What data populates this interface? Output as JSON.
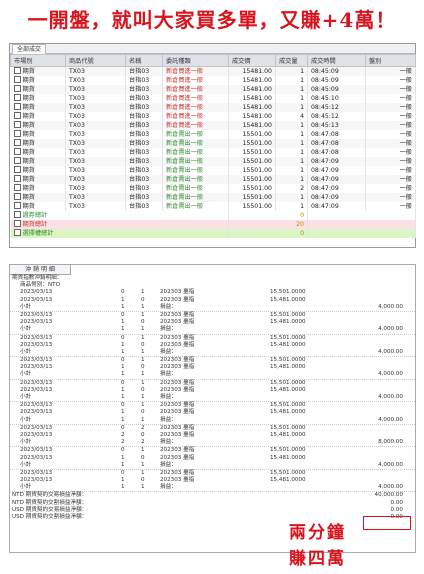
{
  "headline": "一開盤，就叫大家買多單，又賺+4萬！",
  "panel1": {
    "tab": "全部成交",
    "columns": [
      "市場別",
      "商品代號",
      "名稱",
      "委託種類",
      "成交價",
      "成交量",
      "成交時間",
      "盤別"
    ],
    "rows": [
      {
        "market": "期貨",
        "code": "TX03",
        "name": "台指03",
        "type": "新倉買進一般",
        "price": "15481.00",
        "qty": "1",
        "time": "08:45:09",
        "session": "一般",
        "side": "buy"
      },
      {
        "market": "期貨",
        "code": "TX03",
        "name": "台指03",
        "type": "新倉買進一般",
        "price": "15481.00",
        "qty": "1",
        "time": "08:45:09",
        "session": "一般",
        "side": "buy"
      },
      {
        "market": "期貨",
        "code": "TX03",
        "name": "台指03",
        "type": "新倉買進一般",
        "price": "15481.00",
        "qty": "1",
        "time": "08:45:09",
        "session": "一般",
        "side": "buy"
      },
      {
        "market": "期貨",
        "code": "TX03",
        "name": "台指03",
        "type": "新倉買進一般",
        "price": "15481.00",
        "qty": "1",
        "time": "08:45:10",
        "session": "一般",
        "side": "buy"
      },
      {
        "market": "期貨",
        "code": "TX03",
        "name": "台指03",
        "type": "新倉買進一般",
        "price": "15481.00",
        "qty": "1",
        "time": "08:45:12",
        "session": "一般",
        "side": "buy"
      },
      {
        "market": "期貨",
        "code": "TX03",
        "name": "台指03",
        "type": "新倉買進一般",
        "price": "15481.00",
        "qty": "4",
        "time": "08:45:12",
        "session": "一般",
        "side": "buy"
      },
      {
        "market": "期貨",
        "code": "TX03",
        "name": "台指03",
        "type": "新倉買進一般",
        "price": "15481.00",
        "qty": "1",
        "time": "08:45:13",
        "session": "一般",
        "side": "buy"
      },
      {
        "market": "期貨",
        "code": "TX03",
        "name": "台指03",
        "type": "新倉賣出一般",
        "price": "15501.00",
        "qty": "1",
        "time": "08:47:08",
        "session": "一般",
        "side": "sell"
      },
      {
        "market": "期貨",
        "code": "TX03",
        "name": "台指03",
        "type": "新倉賣出一般",
        "price": "15501.00",
        "qty": "1",
        "time": "08:47:08",
        "session": "一般",
        "side": "sell"
      },
      {
        "market": "期貨",
        "code": "TX03",
        "name": "台指03",
        "type": "新倉賣出一般",
        "price": "15501.00",
        "qty": "1",
        "time": "08:47:08",
        "session": "一般",
        "side": "sell"
      },
      {
        "market": "期貨",
        "code": "TX03",
        "name": "台指03",
        "type": "新倉賣出一般",
        "price": "15501.00",
        "qty": "1",
        "time": "08:47:09",
        "session": "一般",
        "side": "sell"
      },
      {
        "market": "期貨",
        "code": "TX03",
        "name": "台指03",
        "type": "新倉賣出一般",
        "price": "15501.00",
        "qty": "1",
        "time": "08:47:09",
        "session": "一般",
        "side": "sell"
      },
      {
        "market": "期貨",
        "code": "TX03",
        "name": "台指03",
        "type": "新倉賣出一般",
        "price": "15501.00",
        "qty": "1",
        "time": "08:47:09",
        "session": "一般",
        "side": "sell"
      },
      {
        "market": "期貨",
        "code": "TX03",
        "name": "台指03",
        "type": "新倉賣出一般",
        "price": "15501.00",
        "qty": "2",
        "time": "08:47:09",
        "session": "一般",
        "side": "sell"
      },
      {
        "market": "期貨",
        "code": "TX03",
        "name": "台指03",
        "type": "新倉賣出一般",
        "price": "15501.00",
        "qty": "1",
        "time": "08:47:09",
        "session": "一般",
        "side": "sell"
      },
      {
        "market": "期貨",
        "code": "TX03",
        "name": "台指03",
        "type": "新倉賣出一般",
        "price": "15501.00",
        "qty": "1",
        "time": "08:47:09",
        "session": "一般",
        "side": "sell"
      }
    ],
    "summary": [
      {
        "label": "證券總計",
        "count": "0"
      },
      {
        "label": "期貨總計",
        "count": "20"
      },
      {
        "label": "選擇權總計",
        "count": "0"
      }
    ]
  },
  "panel2": {
    "tab": "沖 銷 明 細",
    "header1": "期貨指數沖銷明細：",
    "header2": "商品幣別：NTO",
    "lines": [
      {
        "kind": "row",
        "date": "2023/03/13",
        "a": "0",
        "b": "1",
        "code": "202303 臺指",
        "price": "15,501.0000"
      },
      {
        "kind": "row",
        "date": "2023/03/13",
        "a": "1",
        "b": "0",
        "code": "202303 臺指",
        "price": "15,481.0000"
      },
      {
        "kind": "sub",
        "label": "小計",
        "a": "1",
        "b": "1",
        "gain": "損益：",
        "total": "4,000.00"
      },
      {
        "kind": "row",
        "date": "2023/03/13",
        "a": "0",
        "b": "1",
        "code": "202303 臺指",
        "price": "15,501.0000"
      },
      {
        "kind": "row",
        "date": "2023/03/13",
        "a": "1",
        "b": "0",
        "code": "202303 臺指",
        "price": "15,481.0000"
      },
      {
        "kind": "sub",
        "label": "小計",
        "a": "1",
        "b": "1",
        "gain": "損益：",
        "total": "4,000.00"
      },
      {
        "kind": "row",
        "date": "2023/03/13",
        "a": "0",
        "b": "1",
        "code": "202303 臺指",
        "price": "15,501.0000"
      },
      {
        "kind": "row",
        "date": "2023/03/13",
        "a": "1",
        "b": "0",
        "code": "202303 臺指",
        "price": "15,481.0000"
      },
      {
        "kind": "sub",
        "label": "小計",
        "a": "1",
        "b": "1",
        "gain": "損益：",
        "total": "4,000.00"
      },
      {
        "kind": "row",
        "date": "2023/03/13",
        "a": "0",
        "b": "1",
        "code": "202303 臺指",
        "price": "15,501.0000"
      },
      {
        "kind": "row",
        "date": "2023/03/13",
        "a": "1",
        "b": "0",
        "code": "202303 臺指",
        "price": "15,481.0000"
      },
      {
        "kind": "sub",
        "label": "小計",
        "a": "1",
        "b": "1",
        "gain": "損益：",
        "total": "4,000.00"
      },
      {
        "kind": "row",
        "date": "2023/03/13",
        "a": "0",
        "b": "1",
        "code": "202303 臺指",
        "price": "15,501.0000"
      },
      {
        "kind": "row",
        "date": "2023/03/13",
        "a": "1",
        "b": "0",
        "code": "202303 臺指",
        "price": "15,481.0000"
      },
      {
        "kind": "sub",
        "label": "小計",
        "a": "1",
        "b": "1",
        "gain": "損益：",
        "total": "4,000.00"
      },
      {
        "kind": "row",
        "date": "2023/03/13",
        "a": "0",
        "b": "1",
        "code": "202303 臺指",
        "price": "15,501.0000"
      },
      {
        "kind": "row",
        "date": "2023/03/13",
        "a": "1",
        "b": "0",
        "code": "202303 臺指",
        "price": "15,481.0000"
      },
      {
        "kind": "sub",
        "label": "小計",
        "a": "1",
        "b": "1",
        "gain": "損益：",
        "total": "4,000.00"
      },
      {
        "kind": "row",
        "date": "2023/03/13",
        "a": "0",
        "b": "2",
        "code": "202303 臺指",
        "price": "15,501.0000"
      },
      {
        "kind": "row",
        "date": "2023/03/13",
        "a": "2",
        "b": "0",
        "code": "202303 臺指",
        "price": "15,481.0000"
      },
      {
        "kind": "sub",
        "label": "小計",
        "a": "2",
        "b": "2",
        "gain": "損益：",
        "total": "8,000.00"
      },
      {
        "kind": "row",
        "date": "2023/03/13",
        "a": "0",
        "b": "1",
        "code": "202303 臺指",
        "price": "15,501.0000"
      },
      {
        "kind": "row",
        "date": "2023/03/13",
        "a": "1",
        "b": "0",
        "code": "202303 臺指",
        "price": "15,481.0000"
      },
      {
        "kind": "sub",
        "label": "小計",
        "a": "1",
        "b": "1",
        "gain": "損益：",
        "total": "4,000.00"
      },
      {
        "kind": "row",
        "date": "2023/03/13",
        "a": "0",
        "b": "1",
        "code": "202303 臺指",
        "price": "15,501.0000"
      },
      {
        "kind": "row",
        "date": "2023/03/13",
        "a": "1",
        "b": "0",
        "code": "202303 臺指",
        "price": "15,481.0000"
      },
      {
        "kind": "sub",
        "label": "小計",
        "a": "1",
        "b": "1",
        "gain": "損益：",
        "total": "4,000.00"
      }
    ],
    "totals": [
      {
        "label": "NTD 期貨契約交易損益淨額：",
        "value": "40,000.00"
      },
      {
        "label": "NTD 期貨契約交割損益淨額：",
        "value": "0.00"
      },
      {
        "label": "USD 期貨契約交易損益淨額：",
        "value": "0.00"
      },
      {
        "label": "USD 期貨契約交割損益淨額：",
        "value": "0.00"
      }
    ]
  },
  "annotation": {
    "line1": "兩分鐘",
    "line2": "賺四萬"
  },
  "colors": {
    "accent_red": "#d8141e",
    "buy": "#c9302c",
    "sell": "#2f8a2f"
  }
}
